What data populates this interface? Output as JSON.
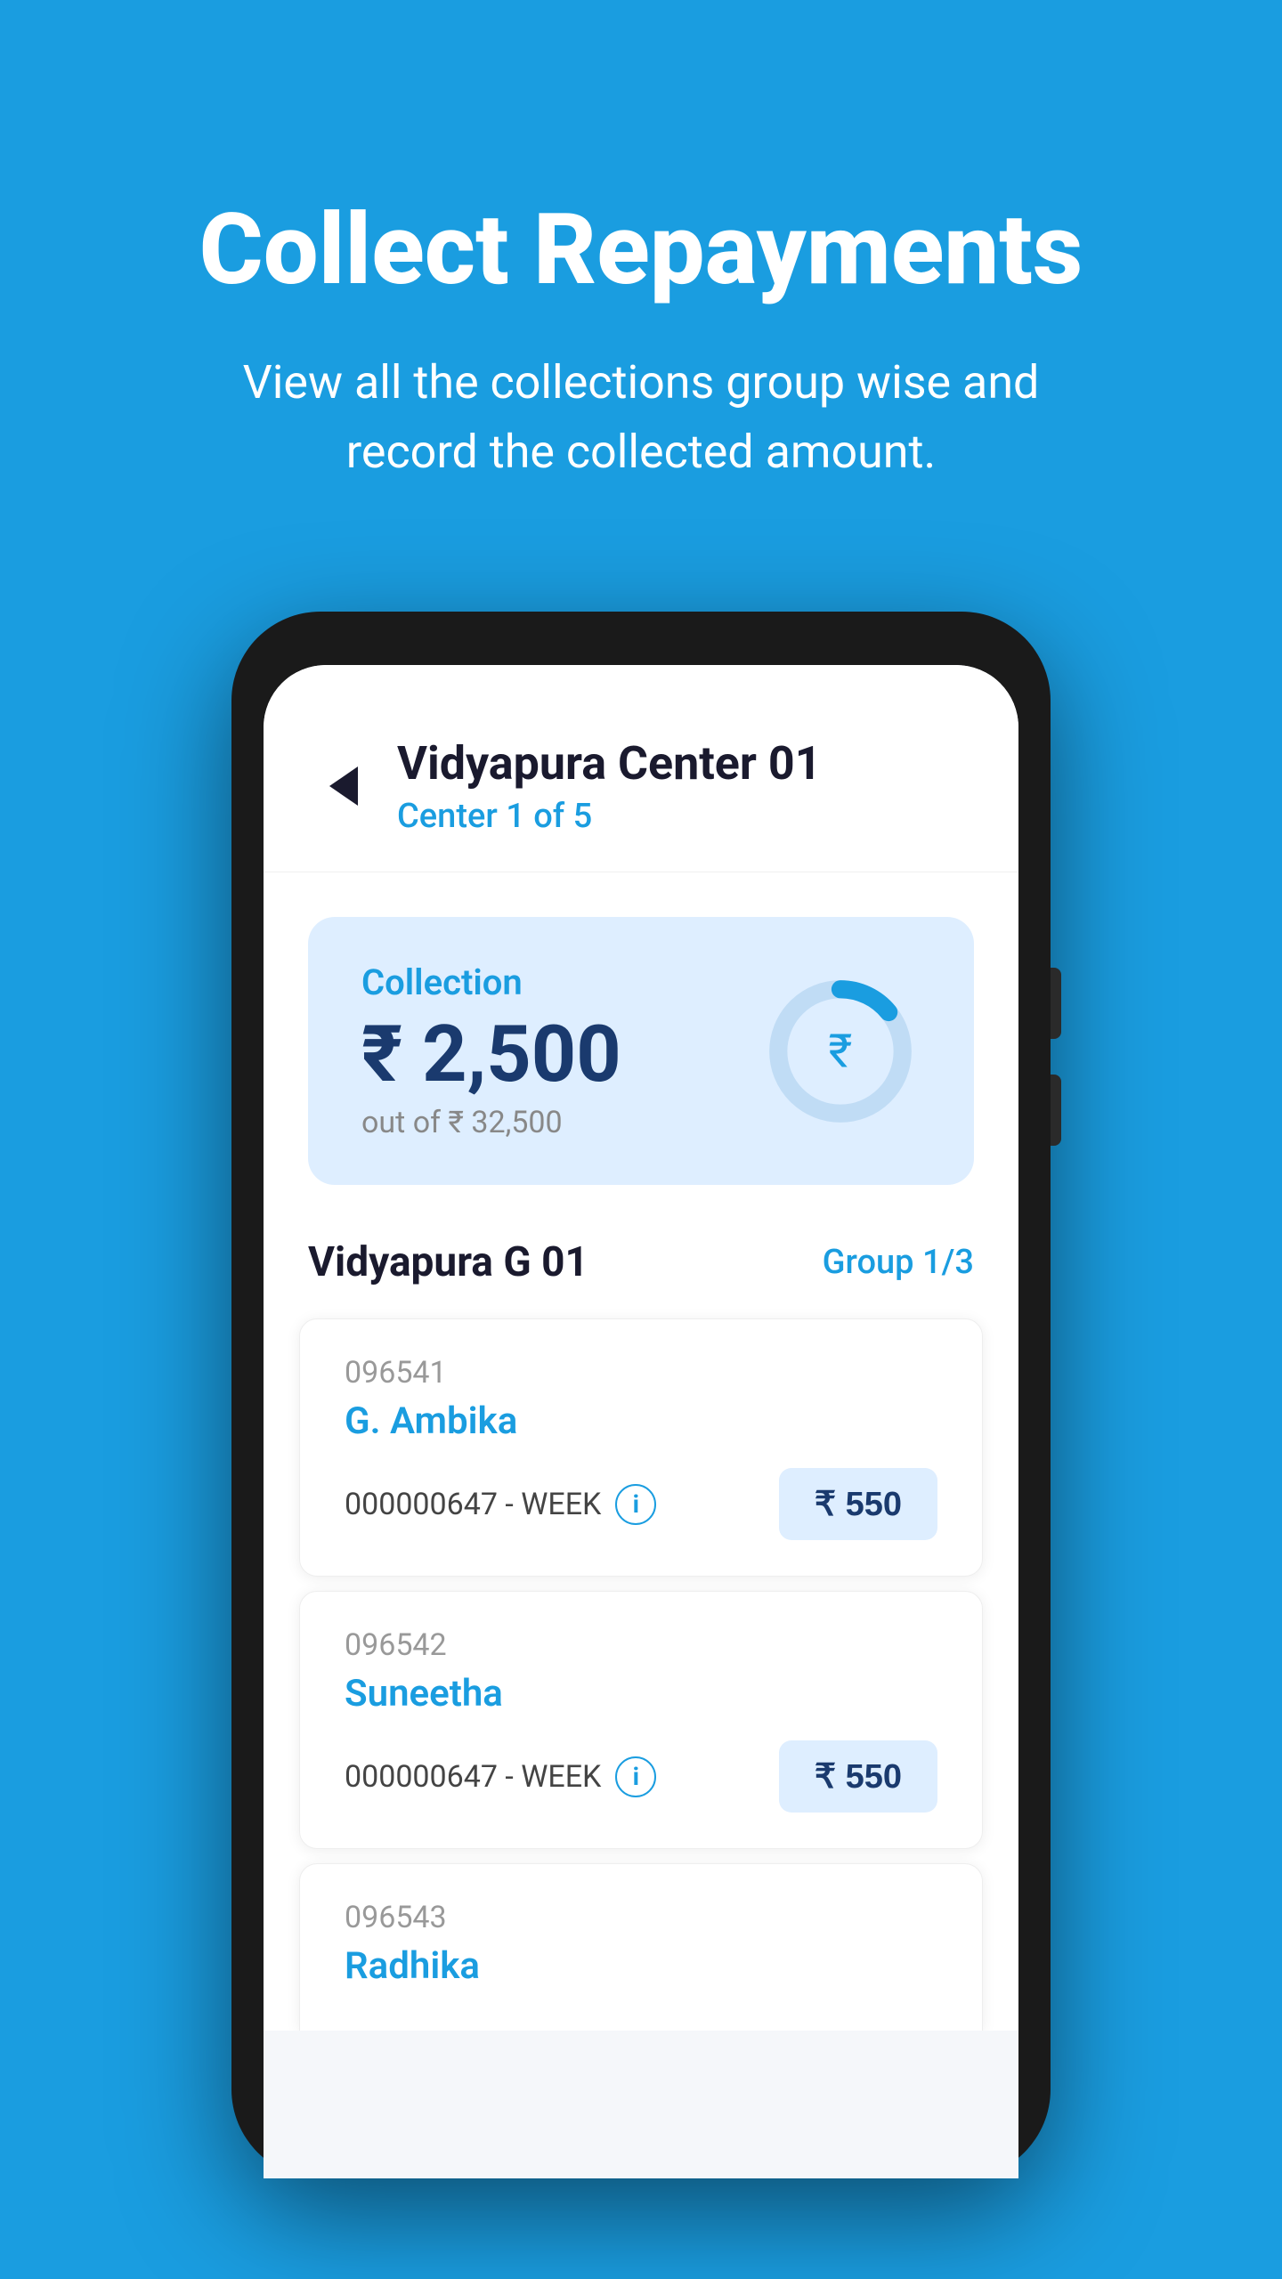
{
  "background_color": "#1a9de0",
  "header": {
    "title": "Collect Repayments",
    "subtitle": "View all the collections group wise and\nrecord the collected amount."
  },
  "screen": {
    "center_name": "Vidyapura Center 01",
    "center_count": "Center 1 of 5",
    "back_label": "←",
    "collection": {
      "label": "Collection",
      "amount": "₹ 2,500",
      "out_of": "out of ₹ 32,500",
      "progress_percent": 7.7
    },
    "group": {
      "name": "Vidyapura G 01",
      "count": "Group 1/3"
    },
    "members": [
      {
        "id": "096541",
        "name": "G. Ambika",
        "loan_code": "000000647 - WEEK",
        "amount": "₹ 550"
      },
      {
        "id": "096542",
        "name": "Suneetha",
        "loan_code": "000000647 - WEEK",
        "amount": "₹ 550"
      },
      {
        "id": "096543",
        "name": "Radhika",
        "loan_code": "",
        "amount": ""
      }
    ]
  }
}
